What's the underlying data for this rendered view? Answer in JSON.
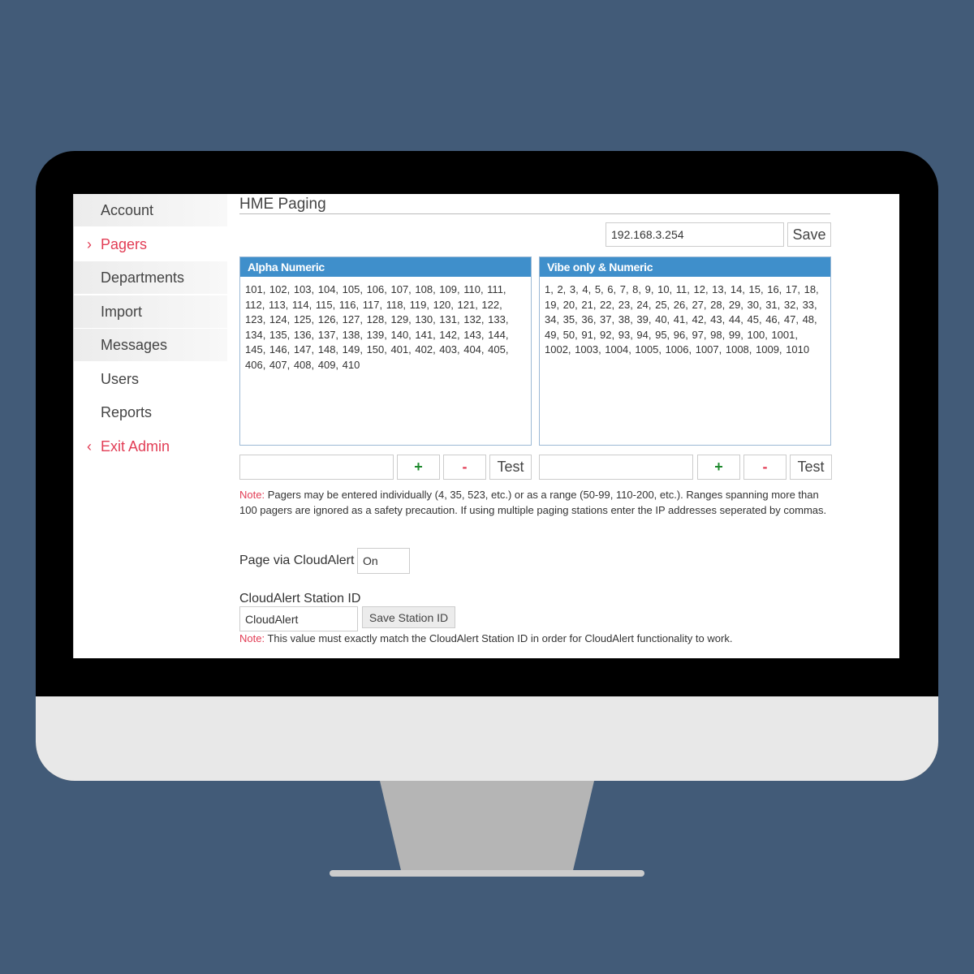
{
  "sidebar": {
    "items": [
      {
        "label": "Account"
      },
      {
        "label": "Pagers",
        "active": true
      },
      {
        "label": "Departments"
      },
      {
        "label": "Import"
      },
      {
        "label": "Messages"
      },
      {
        "label": "Users"
      },
      {
        "label": "Reports"
      }
    ],
    "exit_label": "Exit Admin",
    "chevron_right_icon": "›",
    "chevron_left_icon": "‹"
  },
  "main": {
    "title": "HME Paging",
    "ip_field": {
      "value": "192.168.3.254"
    },
    "save_label": "Save",
    "alpha_panel": {
      "header": "Alpha Numeric",
      "body": "101, 102, 103, 104, 105, 106, 107, 108, 109, 110, 111, 112, 113, 114, 115, 116, 117, 118, 119, 120, 121, 122, 123, 124, 125, 126, 127, 128, 129, 130, 131, 132, 133, 134, 135, 136, 137, 138, 139, 140, 141, 142, 143, 144, 145, 146, 147, 148, 149, 150, 401, 402, 403, 404, 405, 406, 407, 408, 409, 410"
    },
    "vibe_panel": {
      "header": "Vibe only & Numeric",
      "body": "1, 2, 3, 4, 5, 6, 7, 8, 9, 10, 11, 12, 13, 14, 15, 16, 17, 18, 19, 20, 21, 22, 23, 24, 25, 26, 27, 28, 29, 30, 31, 32, 33, 34, 35, 36, 37, 38, 39, 40, 41, 42, 43, 44, 45, 46, 47, 48, 49, 50, 91, 92, 93, 94, 95, 96, 97, 98, 99, 100, 1001, 1002, 1003, 1004, 1005, 1006, 1007, 1008, 1009, 1010"
    },
    "add_label": "+",
    "remove_label": "-",
    "test_label": "Test",
    "note1": {
      "prefix": "Note:",
      "text": " Pagers may be entered individually (4, 35, 523, etc.) or as a range (50-99, 110-200, etc.). Ranges spanning more than 100 pagers are ignored as a safety precaution. If using multiple paging stations enter the IP addresses seperated by commas."
    },
    "cloudalert_label": "Page via CloudAlert",
    "cloudalert_value": "On",
    "station_id_label": "CloudAlert Station ID",
    "station_id_value": "CloudAlert",
    "save_station_label": "Save Station ID",
    "note2": {
      "prefix": "Note:",
      "text": " This value must exactly match the CloudAlert Station ID in order for CloudAlert functionality to work."
    }
  },
  "colors": {
    "background": "#425b78",
    "accent": "#e23d55",
    "panel_header": "#3f8fcb",
    "plus": "#1e8a2e"
  }
}
